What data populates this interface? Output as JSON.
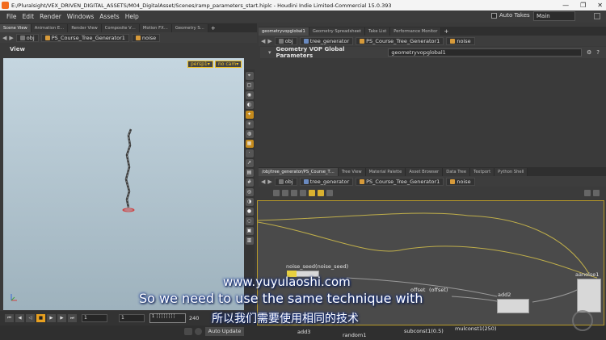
{
  "window": {
    "title": "E:/Pluralsight/VEX_DRIVEN_DIGITAL_ASSETS/M04_DigitalAsset/Scenes/ramp_parameters_start.hiplc - Houdini Indie Limited-Commercial 15.0.393",
    "minimize": "—",
    "maximize": "❐",
    "close": "✕"
  },
  "menu": {
    "items": [
      "File",
      "Edit",
      "Render",
      "Windows",
      "Assets",
      "Help"
    ],
    "auto_takes": "Auto Takes",
    "take": "Main"
  },
  "left_pane": {
    "tabs": [
      "Scene View",
      "Animation E…",
      "Render View",
      "Composite V…",
      "Motion FX…",
      "Geometry S…"
    ],
    "path": {
      "obj": "obj",
      "node": "PS_Course_Tree_Generator1",
      "sub": "noise"
    },
    "viewer_label": "View",
    "camera_persp": "persp1▾",
    "camera_nocam": "no cam▾"
  },
  "playbar": {
    "start_field": "1",
    "current_field": "1",
    "ruler": "1 ┆┆┆┆┆┆┆┆",
    "end_value": "240",
    "auto_update": "Auto Update"
  },
  "right_top": {
    "tabs": [
      "geometryvopglobal1",
      "Geometry Spreadsheet",
      "Take List",
      "Performance Monitor"
    ],
    "path": {
      "obj": "obj",
      "node1": "tree_generator",
      "node2": "PS_Course_Tree_Generator1",
      "node3": "noise"
    },
    "param_title": "Geometry VOP Global Parameters",
    "param_name": "geometryvopglobal1"
  },
  "right_bottom": {
    "tabs": [
      "/obj/tree_generator/PS_Course_T…",
      "Tree View",
      "Material Palette",
      "Asset Browser",
      "Data Tree",
      "Textport",
      "Python Shell"
    ],
    "path": {
      "obj": "obj",
      "node1": "tree_generator",
      "node2": "PS_Course_Tree_Generator1",
      "node3": "noise"
    },
    "nodes": {
      "noise_seed": "noise_seed(noise_seed)",
      "offset": "offset",
      "offset_param": "(offset)",
      "add2": "add2",
      "aanoise1": "aanoise1",
      "add3": "add3",
      "random1": "random1",
      "subconst1": "subconst1(0.5)",
      "mulconst1": "mulconst1(250)"
    }
  },
  "subtitles": {
    "url": "www.yuyulaoshi.com",
    "english": "So we need to use the same technique with",
    "chinese": "所以我们需要使用相同的技术"
  },
  "colors": {
    "accent": "#e8a020",
    "viewport_top": "#c5d6e0",
    "viewport_bottom": "#9eb2bd",
    "network_bg": "#4a4a4a"
  }
}
